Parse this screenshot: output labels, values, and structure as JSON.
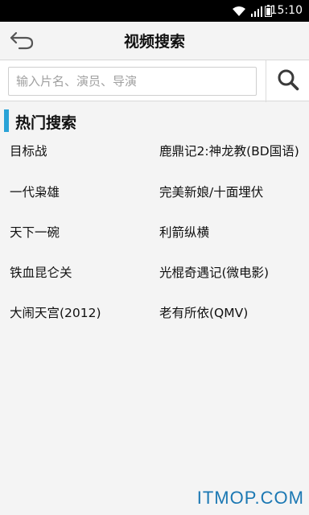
{
  "status_bar": {
    "time": "15:10",
    "icons": [
      "wifi-icon",
      "signal-icon",
      "battery-icon"
    ]
  },
  "header": {
    "back_icon": "back-arrow-icon",
    "title": "视频搜索"
  },
  "search": {
    "placeholder": "输入片名、演员、导演",
    "value": "",
    "button_icon": "search-icon"
  },
  "hot": {
    "title": "热门搜索",
    "accent_color": "#2aa3d7",
    "items": [
      "目标战",
      "鹿鼎记2:神龙教(BD国语)",
      "一代枭雄",
      "完美新娘/十面埋伏",
      "天下一碗",
      "利箭纵横",
      "铁血昆仑关",
      "光棍奇遇记(微电影)",
      "大闹天宫(2012)",
      "老有所依(QMV)"
    ]
  },
  "watermark": "ITMOP.COM"
}
